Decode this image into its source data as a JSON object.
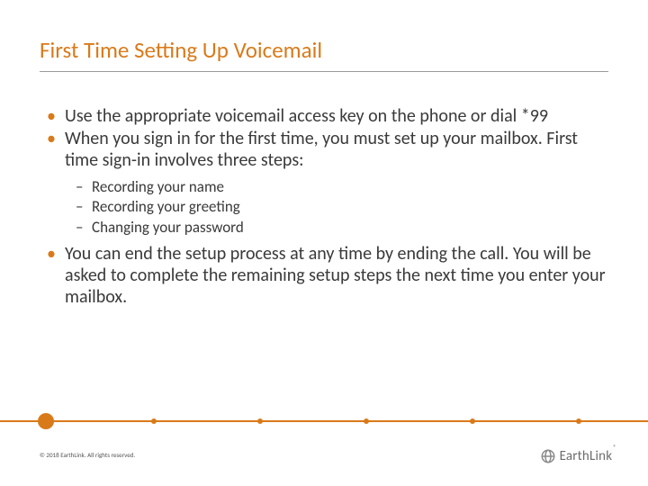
{
  "title": "First Time Setting Up Voicemail",
  "bullets": {
    "b0": "Use the appropriate voicemail access key on the phone or dial *99",
    "b1": "When you sign in for the first time, you must set up your mailbox. First time sign-in involves three steps:",
    "b1_sub": {
      "s0": "Recording your name",
      "s1": "Recording your greeting",
      "s2": "Changing your password"
    },
    "b2": "You can end the setup process at any time by ending the call. You will be asked to complete the remaining setup steps the next time you enter your mailbox."
  },
  "footer": {
    "copyright": "© 2018 EarthLink. All rights reserved.",
    "brand": "EarthLink",
    "trademark": "®"
  },
  "colors": {
    "accent": "#d97a1a"
  }
}
